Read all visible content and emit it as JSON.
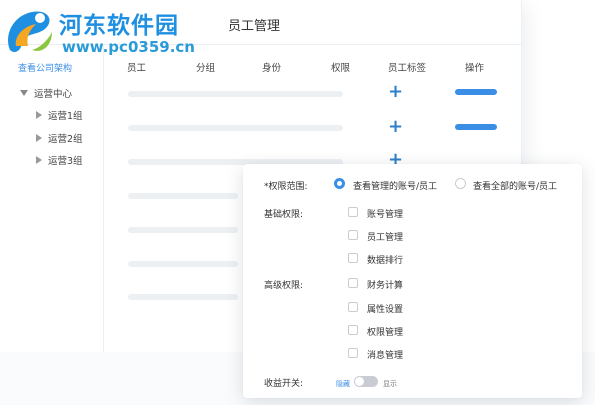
{
  "watermark": {
    "title": "河东软件园",
    "url": "www.pc0359.cn"
  },
  "header": {
    "title": "员工管理"
  },
  "sidebar": {
    "view_org_link": "查看公司架构",
    "tree": {
      "root": "运营中心",
      "children": [
        "运营1组",
        "运营2组",
        "运营3组"
      ]
    }
  },
  "table": {
    "columns": [
      "员工",
      "分组",
      "身份",
      "权限",
      "员工标签",
      "操作"
    ]
  },
  "panel": {
    "scope_label": "*权限范围:",
    "scope_options": [
      "查看管理的账号/员工",
      "查看全部的账号/员工"
    ],
    "scope_selected": 0,
    "basic_label": "基础权限:",
    "basic_items": [
      "账号管理",
      "员工管理",
      "数据排行"
    ],
    "advanced_label": "高级权限:",
    "advanced_items": [
      "财务计算",
      "属性设置",
      "权限管理",
      "消息管理"
    ],
    "income_label": "收益开关:",
    "toggle_off_text": "隐藏",
    "toggle_on_text": "显示",
    "toggle_state": "off"
  },
  "colors": {
    "accent": "#3a8ee6",
    "plus": "#2f7fc9",
    "placeholder_bar": "#edf0f3"
  }
}
